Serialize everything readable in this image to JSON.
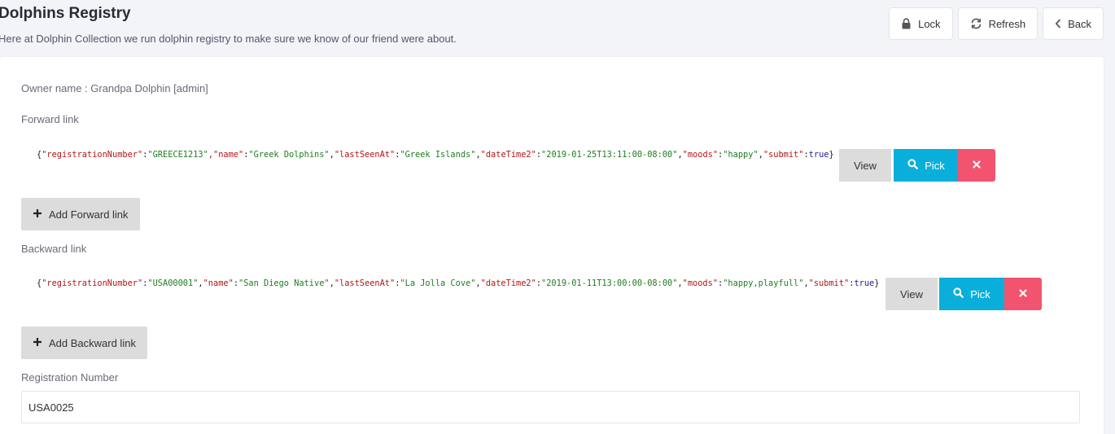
{
  "header": {
    "title": "Dolphins Registry",
    "subtitle": "Here at Dolphin Collection we run dolphin registry to make sure we know of our friend were about.",
    "lock_label": "Lock",
    "refresh_label": "Refresh",
    "back_label": "Back"
  },
  "owner": {
    "text": "Owner name : Grandpa Dolphin [admin]"
  },
  "forward": {
    "label": "Forward link",
    "record": {
      "registrationNumber": "GREECE1213",
      "name": "Greek Dolphins",
      "lastSeenAt": "Greek Islands",
      "dateTime2": "2019-01-25T13:11:00-08:00",
      "moods": "happy",
      "submit": "true"
    },
    "view_label": "View",
    "pick_label": "Pick",
    "add_label": "Add Forward link"
  },
  "backward": {
    "label": "Backward link",
    "record": {
      "registrationNumber": "USA00001",
      "name": "San Diego Native",
      "lastSeenAt": "La Jolla Cove",
      "dateTime2": "2019-01-11T13:00:00-08:00",
      "moods": "happy,playfull",
      "submit": "true"
    },
    "view_label": "View",
    "pick_label": "Pick",
    "add_label": "Add Backward link"
  },
  "registration": {
    "label": "Registration Number",
    "value": "USA0025"
  },
  "colors": {
    "pick": "#0aaedb",
    "remove": "#f2536f",
    "neutral_button": "#dcdcdc",
    "json_key": "#b41515",
    "json_string": "#1e7d1e",
    "json_bool": "#1c1ca8"
  }
}
